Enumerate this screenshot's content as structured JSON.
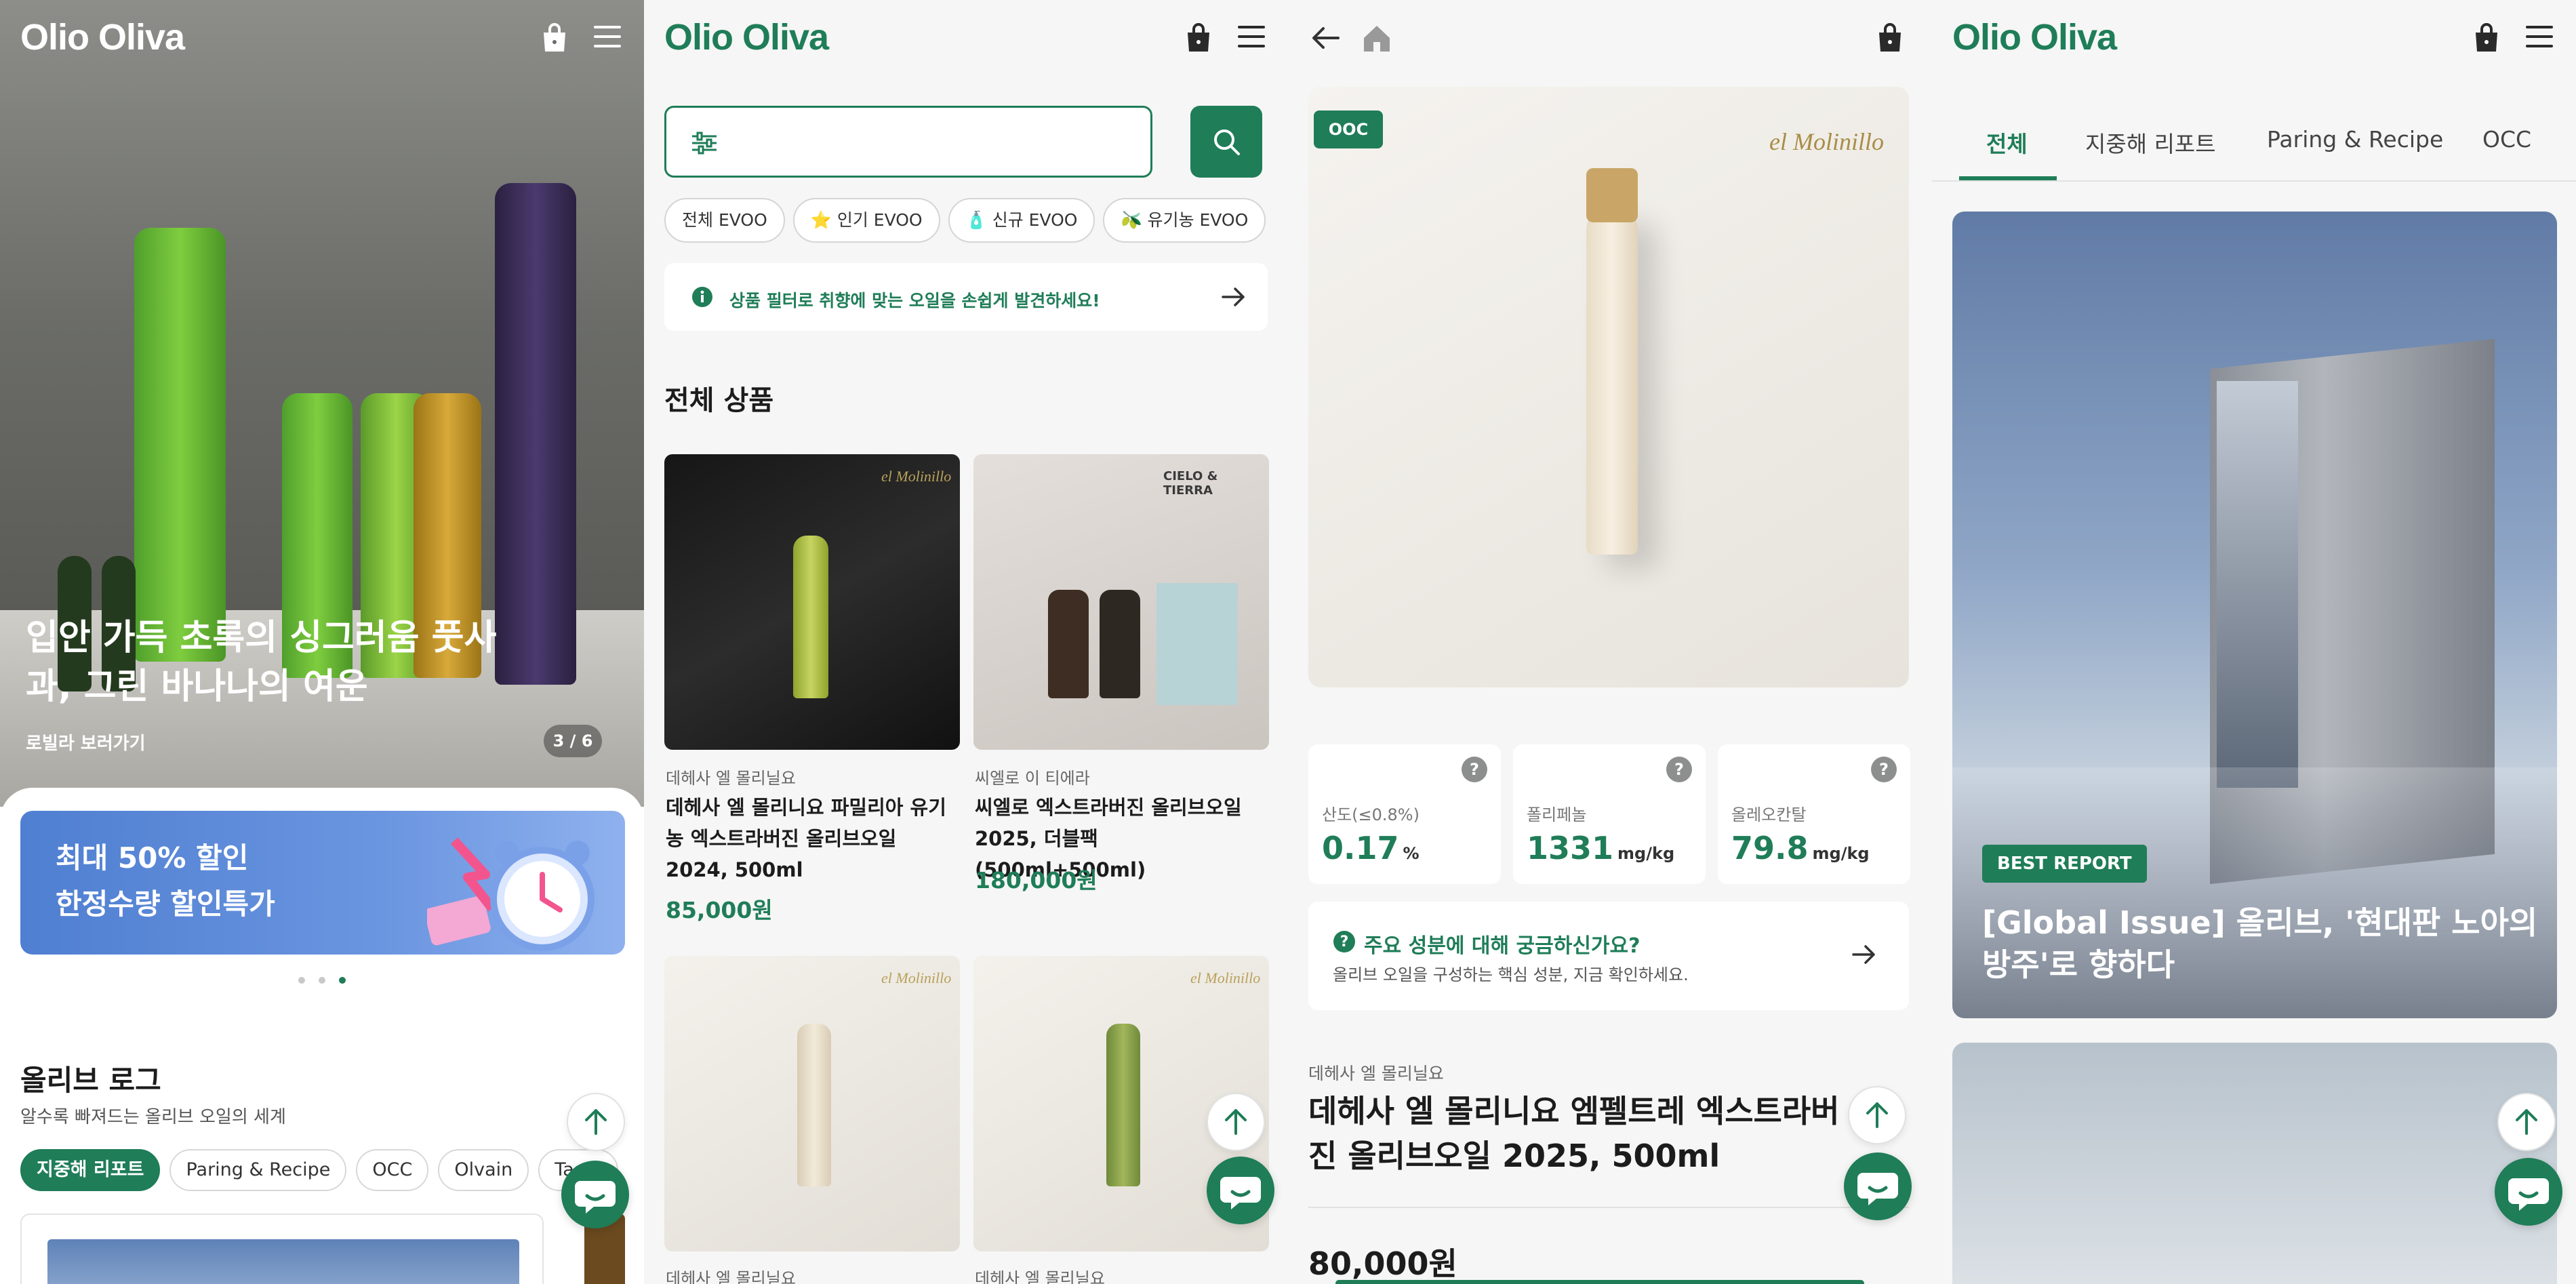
{
  "brand": {
    "logo": "Olio Oliva",
    "accent": "#1f7d58"
  },
  "panel1": {
    "hero": {
      "title": "입안 가득 초록의 싱그러움 풋사과, 그린 바나나의 여운",
      "link": "로빌라 보러가기",
      "counter": "3 / 6"
    },
    "promo": {
      "line1": "최대 50% 할인",
      "line2": "한정수량 할인특가"
    },
    "section": {
      "title": "올리브 로그",
      "subtitle": "알수록 빠져드는 올리브 오일의 세계"
    },
    "chips": [
      "지중해 리포트",
      "Paring & Recipe",
      "OCC",
      "Olvain",
      "Taste"
    ]
  },
  "panel2": {
    "filter_chips": [
      "전체 EVOO",
      "인기 EVOO",
      "신규 EVOO",
      "유기농 EVOO"
    ],
    "notice": "상품 필터로 취향에 맞는 오일을 손쉽게 발견하세요!",
    "section_title": "전체 상품",
    "products": [
      {
        "brand": "데헤사 엘 몰리닐요",
        "name": "데헤사 엘 몰리니요 파밀리아 유기농 엑스트라버진 올리브오일 2024, 500ml",
        "price": "85,000원",
        "logo": "el Molinillo"
      },
      {
        "brand": "씨엘로 이 티에라",
        "name": "씨엘로 엑스트라버진 올리브오일 2025, 더블팩(500ml+500ml)",
        "price": "180,000원",
        "logo": "CIELO & TIERRA"
      },
      {
        "brand": "데헤사 엘 몰리닐요",
        "logo": "el Molinillo"
      },
      {
        "brand": "데헤사 엘 몰리닐요",
        "logo": "el Molinillo"
      }
    ]
  },
  "panel3": {
    "badge": "OOC",
    "logo": "el Molinillo",
    "stats": [
      {
        "label": "산도(≤0.8%)",
        "value": "0.17",
        "unit": "%"
      },
      {
        "label": "폴리페놀",
        "value": "1331",
        "unit": "mg/kg"
      },
      {
        "label": "올레오칸탈",
        "value": "79.8",
        "unit": "mg/kg"
      }
    ],
    "ask": {
      "title": "주요 성분에 대해 궁금하신가요?",
      "desc": "올리브 오일을 구성하는 핵심 성분, 지금 확인하세요."
    },
    "product": {
      "brand": "데헤사 엘 몰리닐요",
      "name": "데헤사 엘 몰리니요 엠펠트레 엑스트라버진 올리브오일 2025, 500ml",
      "price": "80,000원"
    }
  },
  "panel4": {
    "tabs": [
      "전체",
      "지중해 리포트",
      "Paring & Recipe",
      "OCC"
    ],
    "card": {
      "badge": "BEST REPORT",
      "title": "[Global Issue] 올리브, '현대판 노아의 방주'로 향하다"
    }
  }
}
